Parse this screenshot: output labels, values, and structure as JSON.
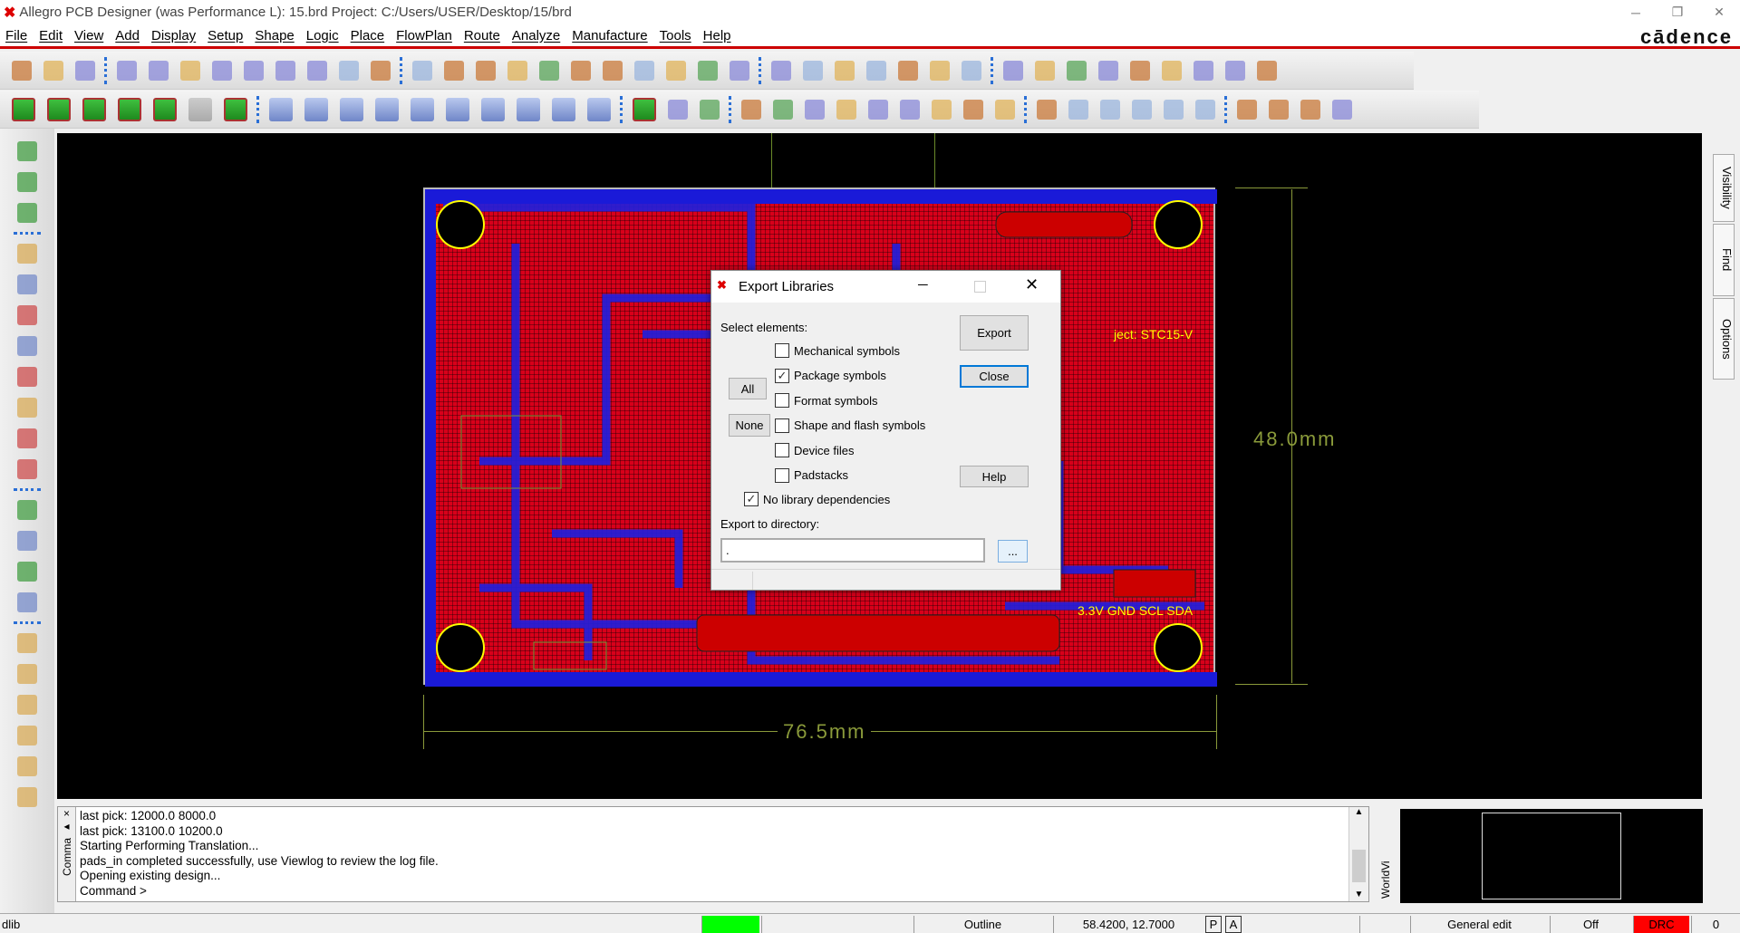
{
  "window": {
    "title": "Allegro PCB Designer (was Performance L): 15.brd  Project: C:/Users/USER/Desktop/15/brd",
    "brand": "cādence"
  },
  "menu": [
    "File",
    "Edit",
    "View",
    "Add",
    "Display",
    "Setup",
    "Shape",
    "Logic",
    "Place",
    "FlowPlan",
    "Route",
    "Analyze",
    "Manufacture",
    "Tools",
    "Help"
  ],
  "toolbar1": [
    [
      "new-file",
      0
    ],
    [
      "open-folder",
      0
    ],
    [
      "save",
      0
    ],
    [
      "|"
    ],
    [
      "move",
      0
    ],
    [
      "copy",
      0
    ],
    [
      "delete",
      0
    ],
    [
      "undo",
      0
    ],
    [
      "undo-down",
      0
    ],
    [
      "redo",
      0
    ],
    [
      "redo-down",
      0
    ],
    [
      "shape-done",
      0
    ],
    [
      "pin",
      0
    ],
    [
      "|"
    ],
    [
      "unrats-all",
      0
    ],
    [
      "rats-all",
      0
    ],
    [
      "zoom-fit",
      0
    ],
    [
      "zoom-window",
      0
    ],
    [
      "zoom-in",
      0
    ],
    [
      "zoom-out",
      0
    ],
    [
      "zoom-previous",
      0
    ],
    [
      "zoom-world",
      0
    ],
    [
      "redraw",
      0
    ],
    [
      "3d-view",
      0
    ],
    [
      "flip",
      0
    ],
    [
      "|"
    ],
    [
      "grid",
      0
    ],
    [
      "color",
      0
    ],
    [
      "layers",
      0
    ],
    [
      "stack",
      0
    ],
    [
      "xsection",
      0
    ],
    [
      "spreadsheet",
      0
    ],
    [
      "globe",
      0
    ],
    [
      "|"
    ],
    [
      "info",
      0
    ],
    [
      "report",
      0
    ],
    [
      "numbers",
      0
    ],
    [
      "highlight",
      0
    ],
    [
      "sun",
      0
    ],
    [
      "dehighlight",
      0
    ],
    [
      "bars",
      0
    ],
    [
      "hourglass",
      0
    ],
    [
      "drc",
      0
    ]
  ],
  "toolbar2": [
    [
      "etch-1",
      1
    ],
    [
      "etch-2",
      1
    ],
    [
      "etch-3",
      1
    ],
    [
      "etch-4",
      1
    ],
    [
      "etch-5",
      1
    ],
    [
      "etch-6",
      2
    ],
    [
      "etch-7",
      1
    ],
    [
      "|"
    ],
    [
      "l-shape",
      3
    ],
    [
      "rect",
      3
    ],
    [
      "circle",
      3
    ],
    [
      "select",
      3
    ],
    [
      "poly",
      3
    ],
    [
      "arc",
      3
    ],
    [
      "square",
      3
    ],
    [
      "round",
      3
    ],
    [
      "slot",
      3
    ],
    [
      "remove",
      3
    ],
    [
      "|"
    ],
    [
      "component",
      1
    ],
    [
      "dimension",
      0
    ],
    [
      "measure",
      0
    ],
    [
      "|"
    ],
    [
      "odb",
      0
    ],
    [
      "library",
      0
    ],
    [
      "tool",
      0
    ],
    [
      "camera",
      0
    ],
    [
      "pads",
      0
    ],
    [
      "flag",
      0
    ],
    [
      "fanout",
      0
    ],
    [
      "key",
      0
    ],
    [
      "matrix",
      0
    ],
    [
      "|"
    ],
    [
      "waveform",
      0
    ],
    [
      "doc-1",
      0
    ],
    [
      "doc-2",
      0
    ],
    [
      "doc-3",
      0
    ],
    [
      "doc-4",
      0
    ],
    [
      "doc-5",
      0
    ],
    [
      "|"
    ],
    [
      "window-1",
      0
    ],
    [
      "window-2",
      0
    ],
    [
      "window-3",
      0
    ],
    [
      "help",
      0
    ]
  ],
  "left_toolbar": [
    "place-manual",
    "place-refdes",
    "swap",
    "|",
    "add-connect",
    "slide",
    "delay-tune",
    "custom-smooth",
    "route-vias",
    "bus",
    "spread",
    "fanout",
    "|",
    "line",
    "rectangle",
    "add-text",
    "edit-text",
    "|",
    "route-1",
    "route-2",
    "route-3",
    "route-4",
    "route-5",
    "route-6"
  ],
  "canvas": {
    "dim_vertical": "48.0mm",
    "dim_horizontal": "76.5mm",
    "colors": {
      "board": "#d8001a",
      "bottom_layer": "#1a1ad8",
      "outline": "#ffff00",
      "dimension": "#8a9a3a"
    }
  },
  "right_tabs": [
    "Visibility",
    "Find",
    "Options"
  ],
  "console": {
    "side_label": "Comma",
    "lines": [
      "last pick:  12000.0 8000.0",
      "last pick:  13100.0 10200.0",
      "Starting Performing Translation...",
      "pads_in completed successfully, use Viewlog to review the log file.",
      "Opening existing design...",
      "Command >"
    ]
  },
  "worldview": {
    "label": "WorldVi"
  },
  "statusbar": {
    "mode": "dlib",
    "layer": "Outline",
    "coords": "58.4200, 12.7000",
    "p": "P",
    "a": "A",
    "edit_mode": "General edit",
    "off": "Off",
    "drc": "DRC",
    "count": "0",
    "colors": {
      "active": "#00ff00",
      "drc": "#ff0000"
    }
  },
  "dialog": {
    "title": "Export Libraries",
    "select_label": "Select elements:",
    "options": [
      {
        "label": "Mechanical symbols",
        "checked": false
      },
      {
        "label": "Package symbols",
        "checked": true
      },
      {
        "label": "Format symbols",
        "checked": false
      },
      {
        "label": "Shape and flash symbols",
        "checked": false
      },
      {
        "label": "Device files",
        "checked": false
      },
      {
        "label": "Padstacks",
        "checked": false
      }
    ],
    "no_deps": {
      "label": "No library dependencies",
      "checked": true
    },
    "all": "All",
    "none": "None",
    "export": "Export",
    "close": "Close",
    "help": "Help",
    "dir_label": "Export to directory:",
    "dir_value": ".",
    "browse": "..."
  }
}
